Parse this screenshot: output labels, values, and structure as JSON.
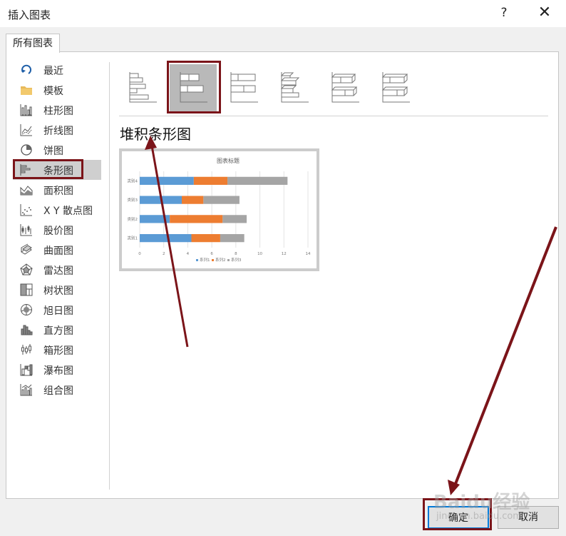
{
  "window": {
    "title": "插入图表",
    "help_label": "?",
    "close_label": "✕"
  },
  "tabs": [
    {
      "label": "所有图表"
    }
  ],
  "sidebar": {
    "items": [
      {
        "label": "最近",
        "icon": "recent-icon"
      },
      {
        "label": "模板",
        "icon": "folder-icon"
      },
      {
        "label": "柱形图",
        "icon": "column-chart-icon"
      },
      {
        "label": "折线图",
        "icon": "line-chart-icon"
      },
      {
        "label": "饼图",
        "icon": "pie-chart-icon"
      },
      {
        "label": "条形图",
        "icon": "bar-chart-icon",
        "selected": true
      },
      {
        "label": "面积图",
        "icon": "area-chart-icon"
      },
      {
        "label": "X Y 散点图",
        "icon": "scatter-chart-icon"
      },
      {
        "label": "股价图",
        "icon": "stock-chart-icon"
      },
      {
        "label": "曲面图",
        "icon": "surface-chart-icon"
      },
      {
        "label": "雷达图",
        "icon": "radar-chart-icon"
      },
      {
        "label": "树状图",
        "icon": "treemap-chart-icon"
      },
      {
        "label": "旭日图",
        "icon": "sunburst-chart-icon"
      },
      {
        "label": "直方图",
        "icon": "histogram-chart-icon"
      },
      {
        "label": "箱形图",
        "icon": "box-whisker-chart-icon"
      },
      {
        "label": "瀑布图",
        "icon": "waterfall-chart-icon"
      },
      {
        "label": "组合图",
        "icon": "combo-chart-icon"
      }
    ]
  },
  "subtypes": [
    {
      "icon": "clustered-bar-icon",
      "selected": false
    },
    {
      "icon": "stacked-bar-icon",
      "selected": true
    },
    {
      "icon": "100-stacked-bar-icon",
      "selected": false
    },
    {
      "icon": "3d-clustered-bar-icon",
      "selected": false
    },
    {
      "icon": "3d-stacked-bar-icon",
      "selected": false
    },
    {
      "icon": "3d-100-stacked-bar-icon",
      "selected": false
    }
  ],
  "selected_subtype_title": "堆积条形图",
  "preview": {
    "chart_data": {
      "type": "bar",
      "stacked": true,
      "orientation": "horizontal",
      "title": "图表标题",
      "categories": [
        "类别1",
        "类别2",
        "类别3",
        "类别4"
      ],
      "series": [
        {
          "name": "系列1",
          "values": [
            4.3,
            2.5,
            3.5,
            4.5
          ],
          "color": "#5b9bd5"
        },
        {
          "name": "系列2",
          "values": [
            2.4,
            4.4,
            1.8,
            2.8
          ],
          "color": "#ed7d31"
        },
        {
          "name": "系列3",
          "values": [
            2.0,
            2.0,
            3.0,
            5.0
          ],
          "color": "#a5a5a5"
        }
      ],
      "xlim": [
        0,
        14
      ],
      "xticks": [
        "0",
        "2",
        "4",
        "6",
        "8",
        "10",
        "12",
        "14"
      ],
      "grid": true,
      "legend": "bottom"
    }
  },
  "buttons": {
    "ok_label": "确定",
    "cancel_label": "取消"
  },
  "watermark": {
    "text": "Baidu经验",
    "subtext": "jingyan.baidu.com"
  },
  "colors": {
    "highlight_box": "#7b1419",
    "ok_border": "#0078d7",
    "selection_bg": "#cfcfcf"
  }
}
